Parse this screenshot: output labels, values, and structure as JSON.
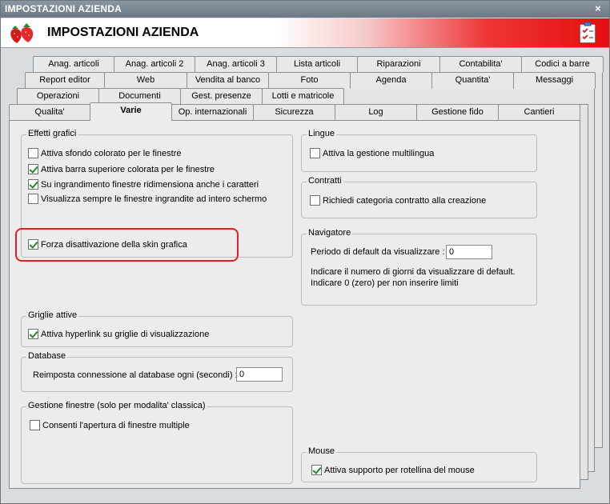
{
  "window": {
    "title": "IMPOSTAZIONI AZIENDA",
    "close_label": "×"
  },
  "header": {
    "title": "IMPOSTAZIONI AZIENDA"
  },
  "tabs": {
    "row1": [
      "Anag. articoli",
      "Anag. articoli 2",
      "Anag. articoli 3",
      "Lista articoli",
      "Riparazioni",
      "Contabilita'",
      "Codici a barre"
    ],
    "row2": [
      "Report editor",
      "Web",
      "Vendita al banco",
      "Foto",
      "Agenda",
      "Quantita'",
      "Messaggi"
    ],
    "row3": [
      "Operazioni",
      "Documenti",
      "Gest. presenze",
      "Lotti e matricole"
    ],
    "row4": [
      "Qualita'",
      "Varie",
      "Op. internazionali",
      "Sicurezza",
      "Log",
      "Gestione fido",
      "Cantieri"
    ]
  },
  "effetti_grafici": {
    "title": "Effetti grafici",
    "opt1": "Attiva sfondo colorato per le finestre",
    "opt2": "Attiva barra superiore colorata per le finestre",
    "opt3": "Su ingrandimento finestre ridimensiona anche i caratteri",
    "opt4": "Visualizza sempre le finestre ingrandite ad intero schermo",
    "opt5": "Forza disattivazione della skin grafica"
  },
  "griglie": {
    "title": "Griglie attive",
    "opt1": "Attiva hyperlink su griglie di visualizzazione"
  },
  "database": {
    "title": "Database",
    "label": "Reimposta connessione al database ogni (secondi) :",
    "value": "0"
  },
  "gestione_finestre": {
    "title": "Gestione finestre (solo per modalita' classica)",
    "opt1": "Consenti l'apertura di finestre multiple"
  },
  "lingue": {
    "title": "Lingue",
    "opt1": "Attiva la gestione multilingua"
  },
  "contratti": {
    "title": "Contratti",
    "opt1": "Richiedi categoria contratto alla creazione"
  },
  "navigatore": {
    "title": "Navigatore",
    "label": "Periodo di default da visualizzare :",
    "value": "0",
    "note1": "Indicare il numero di giorni da visualizzare di default.",
    "note2": "Indicare 0 (zero) per non inserire limiti"
  },
  "mouse": {
    "title": "Mouse",
    "opt1": "Attiva supporto per rotellina del mouse"
  }
}
